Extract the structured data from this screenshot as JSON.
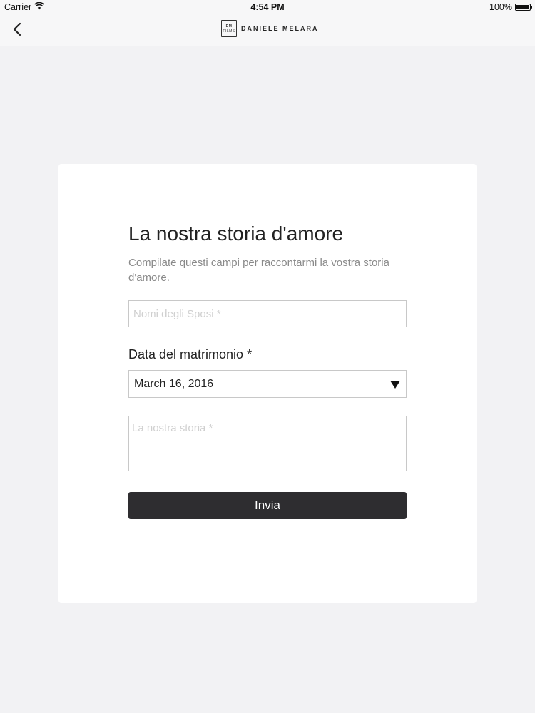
{
  "status_bar": {
    "carrier": "Carrier",
    "time": "4:54 PM",
    "battery": "100%",
    "battery_level": 1.0,
    "icons": [
      "wifi-icon",
      "battery-icon"
    ]
  },
  "nav": {
    "back_icon": "chevron-left-icon",
    "logo_mark_top": "DM",
    "logo_mark_bottom": "FILMS",
    "logo_text": "DANIELE MELARA"
  },
  "form": {
    "title": "La nostra storia d'amore",
    "subtitle": "Compilate questi campi per raccontarmi la vostra storia d'amore.",
    "names_placeholder": "Nomi degli Sposi *",
    "names_value": "",
    "date_label": "Data del matrimonio *",
    "date_value": "March 16, 2016",
    "story_placeholder": "La nostra storia *",
    "story_value": "",
    "submit_label": "Invia"
  },
  "colors": {
    "page_background": "#f2f2f4",
    "card_background": "#ffffff",
    "button_background": "#2e2d30",
    "button_text": "#ffffff",
    "subtitle_text": "#8a8a8a",
    "placeholder_text": "#cfcfcf"
  }
}
